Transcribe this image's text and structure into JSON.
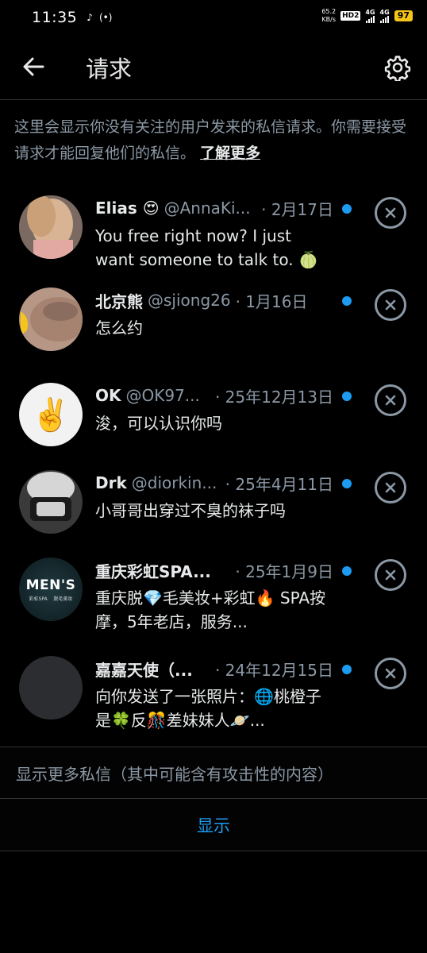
{
  "status_bar": {
    "time": "11:35",
    "net_speed_value": "65.2",
    "net_speed_unit": "KB/s",
    "hd_label": "HD",
    "hd_sub": "2",
    "sim1_label": "4G",
    "sim2_label": "4G",
    "battery": "97"
  },
  "header": {
    "title": "请求",
    "back_icon": "arrow-left-icon",
    "settings_icon": "gear-icon"
  },
  "info": {
    "text": "这里会显示你没有关注的用户发来的私信请求。你需要接受请求才能回复他们的私信。",
    "link": "了解更多"
  },
  "messages": [
    {
      "name": "Elias 😍",
      "handle": "@AnnaKi...",
      "date": "· 2月17日",
      "preview": "You free right now? I just want someone to talk to. 🍈"
    },
    {
      "name": "北京熊",
      "handle": "@sjiong26",
      "date": "· 1月16日",
      "preview": "怎么约"
    },
    {
      "name": "OK",
      "handle": "@OK97...",
      "date": "· 25年12月13日",
      "preview": "浚，可以认识你吗"
    },
    {
      "name": "Drk",
      "handle": "@diorkin...",
      "date": "· 25年4月11日",
      "preview": "小哥哥出穿过不臭的袜子吗"
    },
    {
      "name": "重庆彩虹SPA...",
      "handle": "",
      "date": "· 25年1月9日",
      "preview": "重庆脱💎毛美妆+彩虹🔥 SPA按摩，5年老店，服务...",
      "avatar_title": "MEN'S",
      "avatar_sub": "彩虹SPA    脱毛美妆"
    },
    {
      "name": "嘉嘉天使（...",
      "handle": "",
      "date": "· 24年12月15日",
      "preview": "向你发送了一张照片：🌐桃橙子是🍀反🎊差妹妹人🪐..."
    }
  ],
  "show_more": {
    "label": "显示更多私信（其中可能含有攻击性的内容）",
    "button": "显示"
  },
  "colors": {
    "accent": "#1d9bf0",
    "secondary_text": "#8b98a5",
    "divider": "#2f3336"
  }
}
